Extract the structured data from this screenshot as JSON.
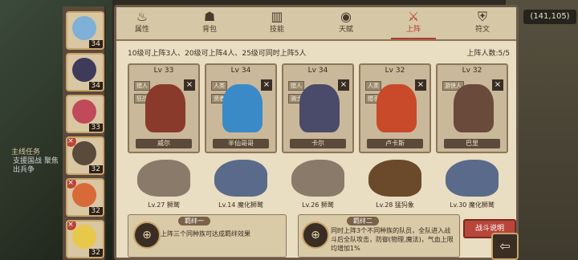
{
  "top_right_counter": "(141,105)",
  "quest": {
    "label": "主线任务",
    "text": "支援国战 聚焦 出兵争"
  },
  "roster": [
    {
      "level": "34",
      "color": "#7fb0d8"
    },
    {
      "level": "34",
      "color": "#3e3a5a"
    },
    {
      "level": "33",
      "color": "#c04a5a"
    },
    {
      "level": "32",
      "color": "#5a4a3c"
    },
    {
      "level": "32",
      "color": "#d86a3a"
    },
    {
      "level": "32",
      "color": "#e8c84a"
    }
  ],
  "tabs": [
    {
      "label": "属性",
      "icon": "flame"
    },
    {
      "label": "背包",
      "icon": "bag"
    },
    {
      "label": "技能",
      "icon": "book"
    },
    {
      "label": "天赋",
      "icon": "eye"
    },
    {
      "label": "上阵",
      "icon": "swords"
    },
    {
      "label": "符文",
      "icon": "rune"
    }
  ],
  "info": {
    "unlock_text": "10级可上阵3人、20级可上阵4人、25级可同时上阵5人",
    "count_text": "上阵人数:5/5"
  },
  "cards": [
    {
      "level": "Lv 33",
      "tag1": "猎人",
      "tag2": "狂战士",
      "name": "威尔",
      "color": "#8a3a2a"
    },
    {
      "level": "Lv 34",
      "tag1": "人类",
      "tag2": "贤者",
      "name": "半仙哥哥",
      "color": "#3a8ac8"
    },
    {
      "level": "Lv 34",
      "tag1": "猎人",
      "tag2": "骑士",
      "name": "卡尔",
      "color": "#4a4a6a"
    },
    {
      "level": "Lv 32",
      "tag1": "人类",
      "tag2": "猎手",
      "name": "卢卡斯",
      "color": "#c84a2a"
    },
    {
      "level": "Lv 32",
      "tag1": "游侠人",
      "tag2": "",
      "name": "巴里",
      "color": "#6a4a3a"
    }
  ],
  "mounts": [
    {
      "label": "Lv.27 狮鹫",
      "color": "#8a7a6a"
    },
    {
      "label": "Lv.14 魔化狮鹫",
      "color": "#5a6a8a"
    },
    {
      "label": "Lv.26 狮鹫",
      "color": "#8a7a6a"
    },
    {
      "label": "Lv.28 猛犸象",
      "color": "#6a4a2a"
    },
    {
      "label": "Lv.30 魔化狮鹫",
      "color": "#5a6a8a"
    }
  ],
  "bonds": [
    {
      "title": "羁绊一",
      "desc": "上阵三个同种族可达成羁绊效果"
    },
    {
      "title": "羁绊二",
      "desc": "同时上阵3个不同种族的队员，全队进入战斗后全队攻击，防御(物理,魔法)，气血上限均增加1%"
    }
  ],
  "battle_button": "战斗说明",
  "exit_icon": "exit-arrow"
}
